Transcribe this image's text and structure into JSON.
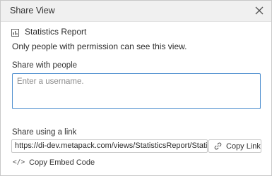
{
  "dialog": {
    "title": "Share View",
    "close_icon": "close-icon"
  },
  "view": {
    "icon": "view-icon",
    "name": "Statistics Report",
    "permission_text": "Only people with permission can see this view."
  },
  "share_people": {
    "label": "Share with people",
    "placeholder": "Enter a username.",
    "value": ""
  },
  "share_link": {
    "label": "Share using a link",
    "url": "https://di-dev.metapack.com/views/StatisticsReport/Statistic",
    "copy_link_label": "Copy Link",
    "copy_link_icon": "link-icon"
  },
  "embed": {
    "icon_glyph": "</>",
    "label": "Copy Embed Code"
  }
}
